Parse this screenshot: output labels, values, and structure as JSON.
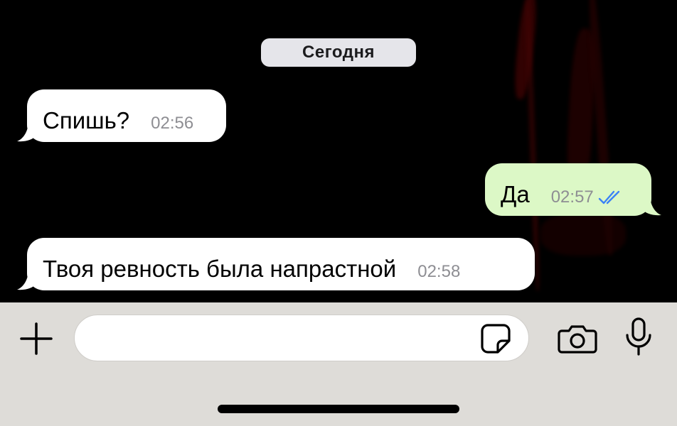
{
  "chat": {
    "date_label": "Сегодня",
    "messages": [
      {
        "direction": "incoming",
        "text": "Спишь?",
        "time": "02:56"
      },
      {
        "direction": "outgoing",
        "text": "Да",
        "time": "02:57",
        "status": "read"
      },
      {
        "direction": "incoming",
        "text": "Твоя ревность была напрастной",
        "time": "02:58"
      }
    ]
  },
  "composer": {
    "value": "",
    "placeholder": "",
    "icons": {
      "attach": "plus-icon",
      "sticker": "sticker-icon",
      "camera": "camera-icon",
      "voice": "microphone-icon"
    }
  },
  "colors": {
    "incoming_bubble": "#ffffff",
    "outgoing_bubble": "#dcf8c6",
    "read_ticks": "#3b82f6",
    "input_bar": "#dedcd8"
  }
}
